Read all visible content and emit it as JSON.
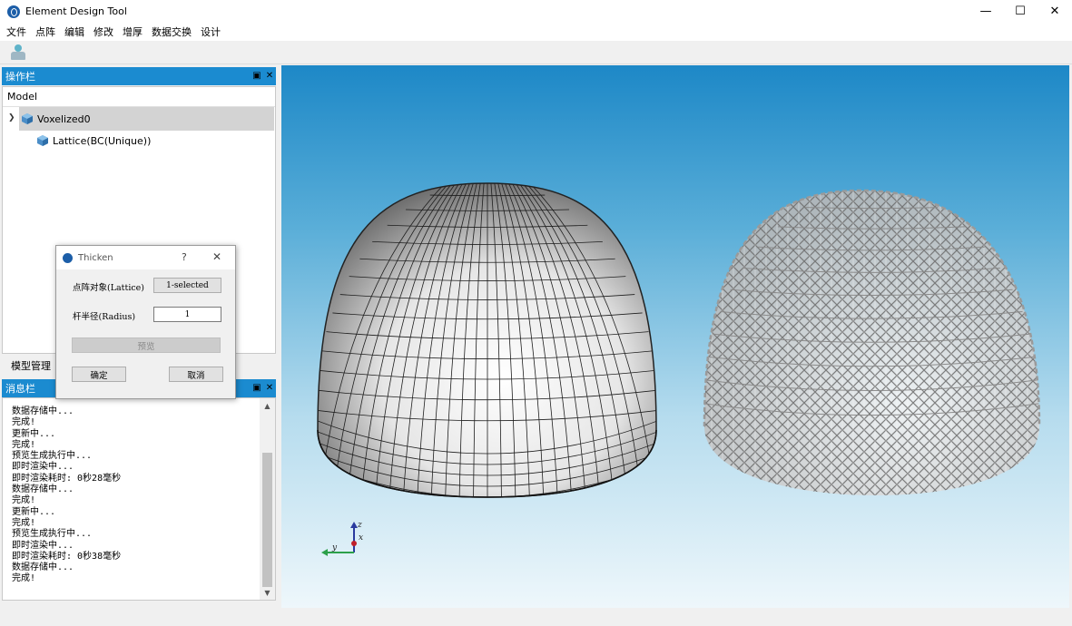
{
  "window": {
    "title": "Element Design Tool",
    "minimize": "—",
    "maximize": "☐",
    "close": "✕"
  },
  "menu": [
    "文件",
    "点阵",
    "编辑",
    "修改",
    "增厚",
    "数据交换",
    "设计"
  ],
  "operation_panel": {
    "title": "操作栏",
    "tree_header": "Model",
    "items": [
      {
        "label": "Voxelized0",
        "expanded": true,
        "selected": true
      },
      {
        "label": "Lattice(BC(Unique))"
      }
    ],
    "tab_label": "模型管理"
  },
  "message_panel": {
    "title": "消息栏",
    "lines": [
      "数据存储中...",
      "完成!",
      "更新中...",
      "完成!",
      "预览生成执行中...",
      "即时渲染中...",
      "即时渲染耗时: 0秒28毫秒",
      "数据存储中...",
      "完成!",
      "更新中...",
      "完成!",
      "预览生成执行中...",
      "即时渲染中...",
      "即时渲染耗时: 0秒38毫秒",
      "数据存储中...",
      "完成!"
    ]
  },
  "dialog": {
    "title": "Thicken",
    "help": "?",
    "close": "✕",
    "lattice_label": "点阵对象(Lattice)",
    "lattice_value": "1-selected",
    "radius_label": "杆半径(Radius)",
    "radius_value": "1",
    "preview_button": "预览",
    "ok_button": "确定",
    "cancel_button": "取消"
  },
  "axes": {
    "z": "z",
    "y": "y",
    "x": "x"
  },
  "colors": {
    "dock_title": "#1b8bd0",
    "viewport_top": "#1d88c7",
    "viewport_bottom": "#eef7fb"
  }
}
